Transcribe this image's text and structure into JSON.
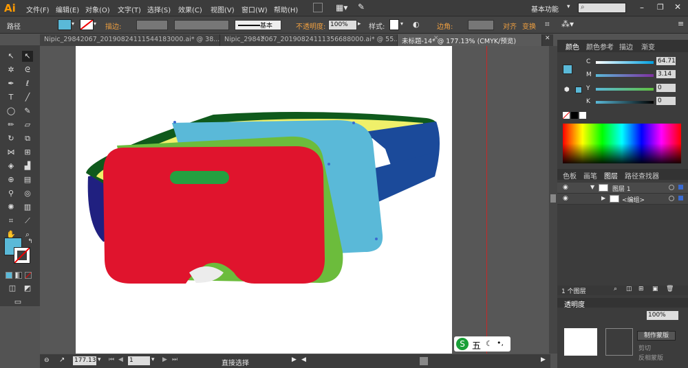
{
  "app": {
    "logo": "Ai",
    "workspace": "基本功能",
    "search_placeholder": ""
  },
  "menu": [
    "文件(F)",
    "编辑(E)",
    "对象(O)",
    "文字(T)",
    "选择(S)",
    "效果(C)",
    "视图(V)",
    "窗口(W)",
    "帮助(H)"
  ],
  "control": {
    "type_label": "路径",
    "stroke_label": "描边:",
    "stroke_style": "基本",
    "opacity_label": "不透明度:",
    "opacity_value": "100%",
    "style_label": "样式:",
    "corner_label": "边角:",
    "align_label": "对齐",
    "transform_label": "变换",
    "fill_color": "#5ab9d8"
  },
  "tabs": [
    {
      "label": "Nipic_29842067_20190824111544183000.ai* @ 38...",
      "active": false
    },
    {
      "label": "Nipic_29842067_20190824111356688000.ai* @ 55...",
      "active": false
    },
    {
      "label": "未标题-14* @ 177.13% (CMYK/预览)",
      "active": true
    }
  ],
  "status": {
    "zoom": "177.13",
    "page": "1",
    "tool_name": "直接选择"
  },
  "color_panel": {
    "tabs": [
      "颜色",
      "颜色参考",
      "描边",
      "渐变"
    ],
    "channels": [
      {
        "name": "C",
        "value": "64.71"
      },
      {
        "name": "M",
        "value": "3.14"
      },
      {
        "name": "Y",
        "value": "0"
      },
      {
        "name": "K",
        "value": "0"
      }
    ]
  },
  "layers_panel": {
    "tabs": [
      "色板",
      "画笔",
      "图层",
      "路径查找器"
    ],
    "layers": [
      {
        "name": "图层 1"
      },
      {
        "name": "<编组>"
      }
    ],
    "count": "1 个图层"
  },
  "transparency_panel": {
    "tab": "透明度",
    "opacity": "100%",
    "make_mask": "制作蒙版",
    "clip": "剪切",
    "invert": "反相蒙版"
  },
  "watermark": {
    "text": "五"
  },
  "colors": {
    "red": "#e0142d",
    "green": "#6cbc3c",
    "lightblue": "#5ab9d8",
    "darkblue": "#1b4a9a",
    "yellow": "#f0f06a",
    "darkgreen": "#0f5a1c",
    "navy": "#202080",
    "slot": "#24a040"
  }
}
